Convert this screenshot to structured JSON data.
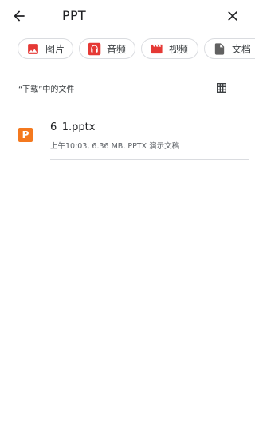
{
  "header": {
    "back_icon": "arrow-left-icon",
    "query": "PPT",
    "close_icon": "close-icon"
  },
  "chips": [
    {
      "label": "图片",
      "icon": "image-icon",
      "color": "#e53935"
    },
    {
      "label": "音频",
      "icon": "headphones-icon",
      "color": "#e53935"
    },
    {
      "label": "视频",
      "icon": "movie-icon",
      "color": "#e53935"
    },
    {
      "label": "文档",
      "icon": "document-icon",
      "color": "#616161"
    }
  ],
  "section": {
    "title": "“下载”中的文件",
    "grid_icon": "grid-view-icon"
  },
  "files": [
    {
      "name": "6_1.pptx",
      "meta": "上午10:03, 6.36 MB, PPTX 演示文稿",
      "icon_letter": "P",
      "icon_color": "#f4791f"
    }
  ]
}
